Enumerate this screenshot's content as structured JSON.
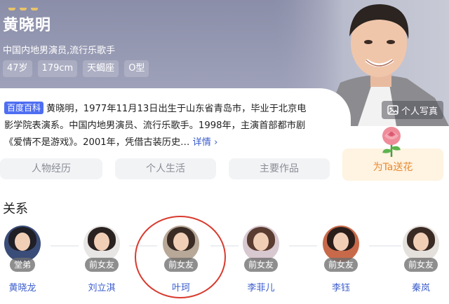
{
  "profile": {
    "name": "黄晓明",
    "occupation": "中国内地男演员,流行乐歌手",
    "tags": [
      "47岁",
      "179cm",
      "天蝎座",
      "O型"
    ],
    "photo_button": "个人写真"
  },
  "bio": {
    "source_badge": "百度百科",
    "text": "黄晓明，1977年11月13日出生于山东省青岛市，毕业于北京电影学院表演系。中国内地男演员、流行乐歌手。1998年，主演首部都市剧《爱情不是游戏》。2001年，凭借古装历史…",
    "more_label": "详情 ›"
  },
  "tabs": [
    "人物经历",
    "个人生活",
    "主要作品"
  ],
  "flower_button": "为Ta送花",
  "relations": {
    "title": "关系",
    "people": [
      {
        "relation": "堂弟",
        "name": "黄晓龙"
      },
      {
        "relation": "前女友",
        "name": "刘立淇"
      },
      {
        "relation": "前女友",
        "name": "叶珂"
      },
      {
        "relation": "前女友",
        "name": "李菲儿"
      },
      {
        "relation": "前女友",
        "name": "李钰"
      },
      {
        "relation": "前女友",
        "name": "秦岚"
      }
    ]
  },
  "colors": {
    "header": "#9a9db6",
    "link": "#3a5ccc",
    "baike_badge": "#4e6ef2",
    "highlight_circle": "#d83a2e",
    "flower_text": "#e58a2f"
  },
  "icons": {
    "photo": "image-icon",
    "flower": "rose-icon"
  }
}
